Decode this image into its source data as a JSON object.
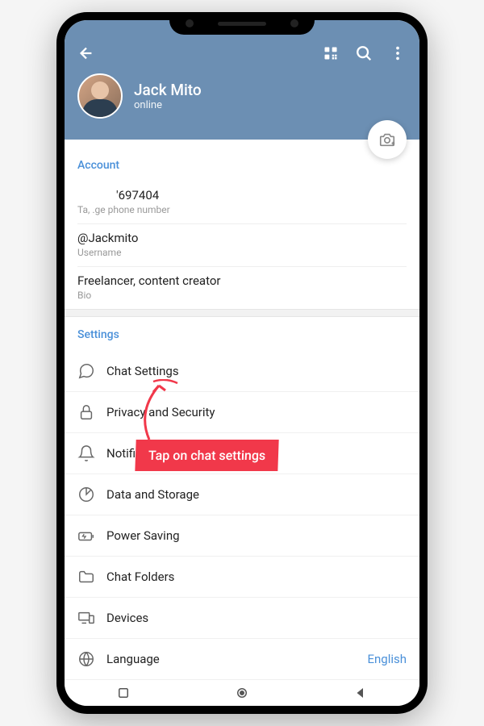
{
  "header": {
    "name": "Jack Mito",
    "status": "online"
  },
  "account": {
    "section_title": "Account",
    "phone_fragment": "'697404",
    "phone_action_fragment": "Ta,    .ge phone number",
    "username": "@Jackmito",
    "username_label": "Username",
    "bio": "Freelancer, content creator",
    "bio_label": "Bio"
  },
  "settings": {
    "section_title": "Settings",
    "items": [
      {
        "label": "Chat Settings"
      },
      {
        "label": "Privacy and Security"
      },
      {
        "label": "Notifications and Sounds"
      },
      {
        "label": "Data and Storage"
      },
      {
        "label": "Power Saving"
      },
      {
        "label": "Chat Folders"
      },
      {
        "label": "Devices"
      },
      {
        "label": "Language",
        "value": "English"
      }
    ]
  },
  "annotation": {
    "text": "Tap on chat settings"
  }
}
